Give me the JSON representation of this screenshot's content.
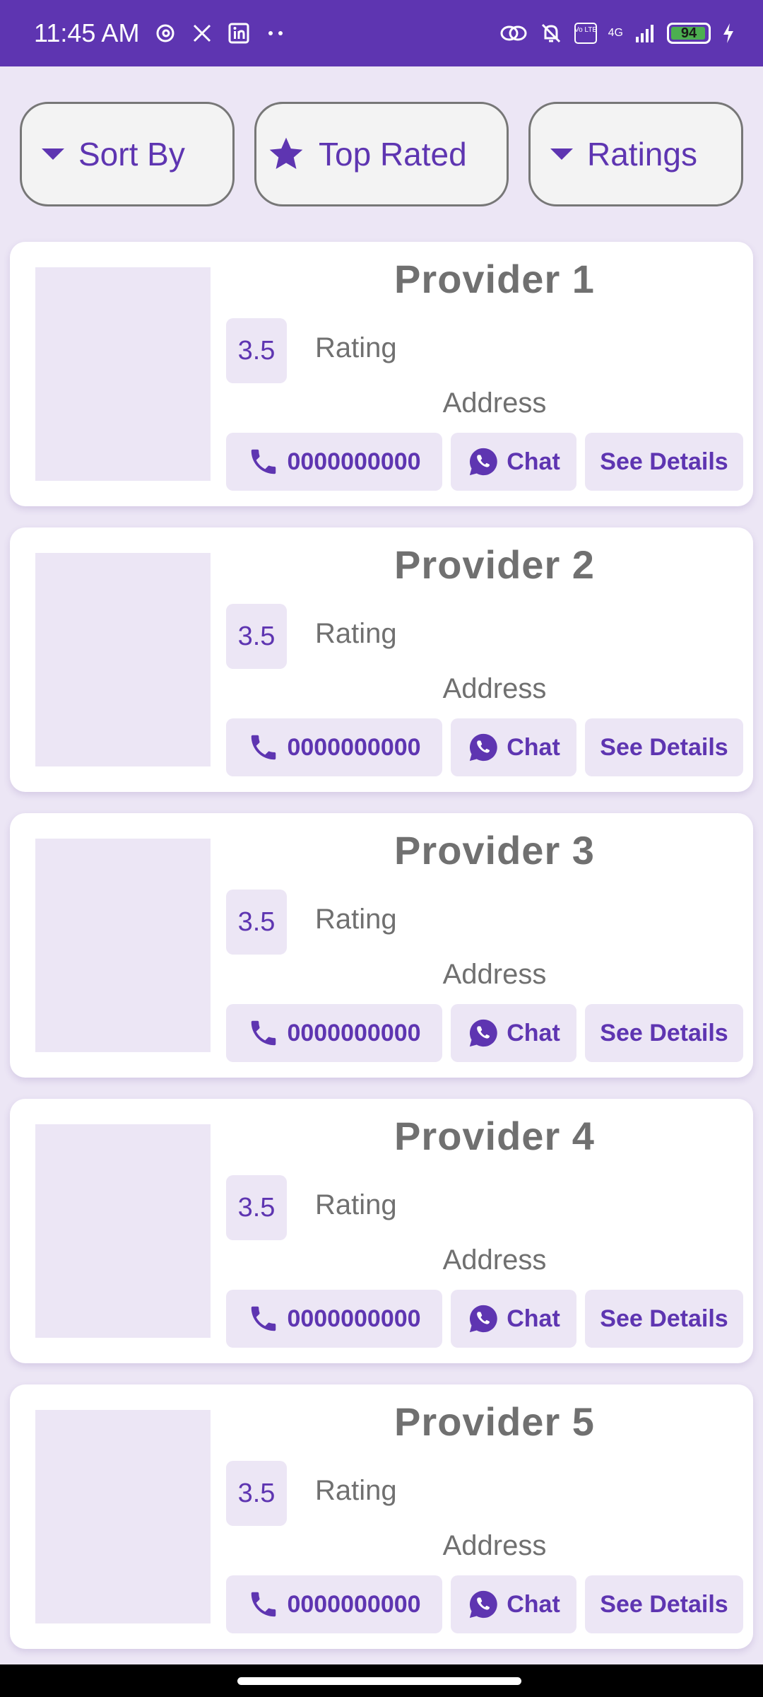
{
  "status_bar": {
    "time": "11:45 AM",
    "icons_left": [
      "threads-icon",
      "x-icon",
      "linkedin-icon",
      "more-dots-icon"
    ],
    "network_label": "4G",
    "volte_label": "Vo LTE",
    "battery": "94"
  },
  "filters": {
    "sort_label": "Sort By",
    "top_rated_label": "Top Rated",
    "ratings_label": "Ratings"
  },
  "colors": {
    "accent": "#5e35b1",
    "background": "#ece6f5",
    "card": "#ffffff",
    "muted_text": "#707070"
  },
  "providers": [
    {
      "name": "Provider 1",
      "rating": "3.5",
      "rating_label": "Rating",
      "address": "Address",
      "phone": "0000000000",
      "chat_label": "Chat",
      "details_label": "See Details"
    },
    {
      "name": "Provider 2",
      "rating": "3.5",
      "rating_label": "Rating",
      "address": "Address",
      "phone": "0000000000",
      "chat_label": "Chat",
      "details_label": "See Details"
    },
    {
      "name": "Provider 3",
      "rating": "3.5",
      "rating_label": "Rating",
      "address": "Address",
      "phone": "0000000000",
      "chat_label": "Chat",
      "details_label": "See Details"
    },
    {
      "name": "Provider 4",
      "rating": "3.5",
      "rating_label": "Rating",
      "address": "Address",
      "phone": "0000000000",
      "chat_label": "Chat",
      "details_label": "See Details"
    },
    {
      "name": "Provider 5",
      "rating": "3.5",
      "rating_label": "Rating",
      "address": "Address",
      "phone": "0000000000",
      "chat_label": "Chat",
      "details_label": "See Details"
    }
  ]
}
